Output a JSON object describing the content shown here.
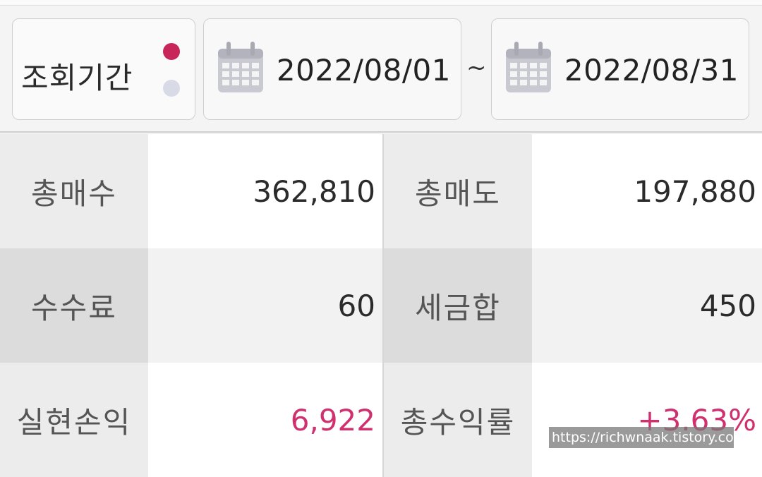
{
  "period": {
    "label": "조회기간",
    "start_date": "2022/08/01",
    "separator": "~",
    "end_date": "2022/08/31",
    "indicator_active_color": "#c8265a",
    "indicator_inactive_color": "#d8dbe6",
    "calendar_icon": "calendar-icon"
  },
  "summary": {
    "rows": [
      {
        "left_label": "총매수",
        "left_value": "362,810",
        "right_label": "총매도",
        "right_value": "197,880"
      },
      {
        "left_label": "수수료",
        "left_value": "60",
        "right_label": "세금합",
        "right_value": "450"
      },
      {
        "left_label": "실현손익",
        "left_value": "6,922",
        "right_label": "총수익률",
        "right_value": "+3.63%"
      }
    ],
    "profit_color": "#d0306e"
  },
  "watermark": "https://richwnaak.tistory.com"
}
